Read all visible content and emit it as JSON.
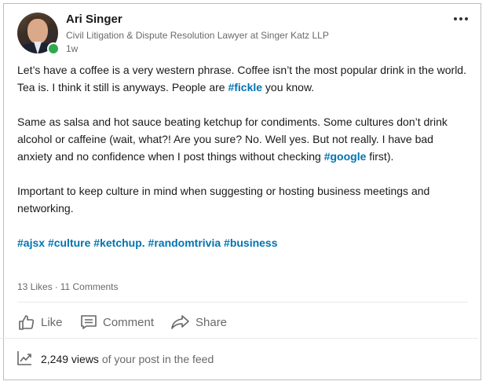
{
  "author": {
    "name": "Ari Singer",
    "headline": "Civil Litigation & Dispute Resolution Lawyer at Singer Katz LLP",
    "time": "1w",
    "presence_color": "#2fa84f"
  },
  "post": {
    "p1_a": "Let’s have a coffee is a very western phrase.  Coffee isn’t the most popular drink in the world. Tea is. I think it still is anyways. People are ",
    "p1_tag": "#fickle",
    "p1_b": " you know.",
    "p2_a": "Same as salsa and hot sauce beating ketchup for condiments. Some cultures don’t drink alcohol or caffeine (wait, what?! Are you sure? No. Well yes. But not really. I have bad anxiety and no confidence when I post things without checking ",
    "p2_tag": "#google",
    "p2_b": " first).",
    "p3": "Important to keep culture in mind when suggesting or hosting business meetings and networking.",
    "tags": [
      "#ajsx",
      "#culture",
      "#ketchup",
      ".",
      "#randomtrivia",
      "#business"
    ]
  },
  "social": {
    "likes": "13 Likes",
    "separator": "·",
    "comments": "11 Comments"
  },
  "actions": {
    "like": "Like",
    "comment": "Comment",
    "share": "Share"
  },
  "views": {
    "count": "2,249 views",
    "suffix": " of your post in the feed"
  },
  "colors": {
    "hashtag": "#0073b1",
    "text": "#000000e6",
    "muted": "#00000099"
  },
  "icons": {
    "more": "more-icon",
    "like": "thumbs-up-icon",
    "comment": "comment-icon",
    "share": "share-arrow-icon",
    "views": "trend-chart-icon"
  }
}
